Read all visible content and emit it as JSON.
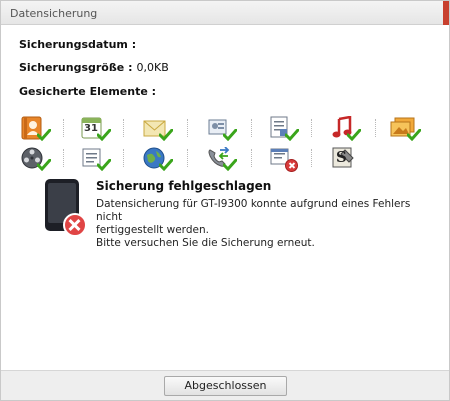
{
  "window": {
    "title": "Datensicherung"
  },
  "details": {
    "date_label": "Sicherungsdatum :",
    "date_value": "",
    "size_label": "Sicherungsgröße :",
    "size_value": "0,0KB",
    "items_label": "Gesicherte Elemente :"
  },
  "items": [
    {
      "icon": "contacts-icon",
      "status": "ok"
    },
    {
      "icon": "calendar-icon",
      "status": "ok",
      "calendar_day": "31"
    },
    {
      "icon": "messages-icon",
      "status": "ok"
    },
    {
      "icon": "media-icon",
      "status": "ok"
    },
    {
      "icon": "notes-icon",
      "status": "ok"
    },
    {
      "icon": "music-icon",
      "status": "ok"
    },
    {
      "icon": "photos-icon",
      "status": "ok"
    },
    {
      "icon": "video-icon",
      "status": "ok"
    },
    {
      "icon": "memo-icon",
      "status": "ok"
    },
    {
      "icon": "internet-icon",
      "status": "ok"
    },
    {
      "icon": "call-log-icon",
      "status": "ok"
    },
    {
      "icon": "settings-doc-icon",
      "status": "error"
    },
    {
      "icon": "app-icon",
      "status": "none",
      "letter": "S"
    }
  ],
  "error": {
    "title": "Sicherung fehlgeschlagen",
    "line1": "Datensicherung für GT-I9300  konnte aufgrund eines Fehlers nicht",
    "line2": "fertiggestellt werden.",
    "line3": "Bitte versuchen Sie die Sicherung erneut."
  },
  "footer": {
    "button_label": "Abgeschlossen"
  },
  "colors": {
    "accent": "#c8402e",
    "check": "#3aa51b",
    "error": "#d83b3b"
  }
}
